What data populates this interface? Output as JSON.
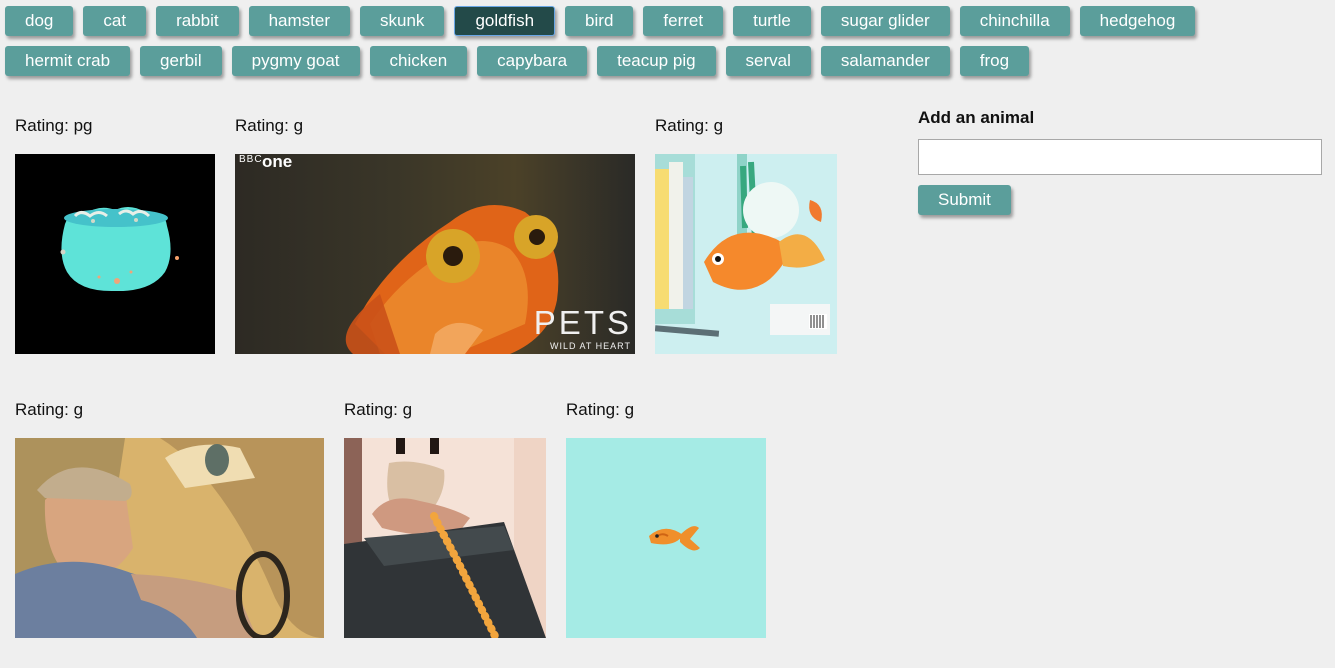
{
  "animal_buttons": {
    "row1": [
      "dog",
      "cat",
      "rabbit",
      "hamster",
      "skunk",
      "goldfish",
      "bird",
      "ferret",
      "turtle",
      "sugar glider",
      "chinchilla",
      "hedgehog"
    ],
    "row2": [
      "hermit crab",
      "gerbil",
      "pygmy goat",
      "chicken",
      "capybara",
      "teacup pig",
      "serval",
      "salamander",
      "frog"
    ],
    "active": "goldfish"
  },
  "gifs": {
    "row1": [
      {
        "rating": "Rating: pg",
        "description": "goldfish-bowl-gif"
      },
      {
        "rating": "Rating: g",
        "description": "bbc-goldfish-gif",
        "watermark_channel": "one",
        "watermark_title": "PETS",
        "watermark_subtitle": "WILD AT HEART"
      },
      {
        "rating": "Rating: g",
        "description": "illustrated-goldfish-gif"
      }
    ],
    "row2": [
      {
        "rating": "Rating: g",
        "description": "man-driving-gif"
      },
      {
        "rating": "Rating: g",
        "description": "treadmill-goldfish-crackers-gif"
      },
      {
        "rating": "Rating: g",
        "description": "goldfish-cracker-gif"
      }
    ]
  },
  "form": {
    "label": "Add an animal",
    "input_value": "",
    "submit_label": "Submit"
  }
}
